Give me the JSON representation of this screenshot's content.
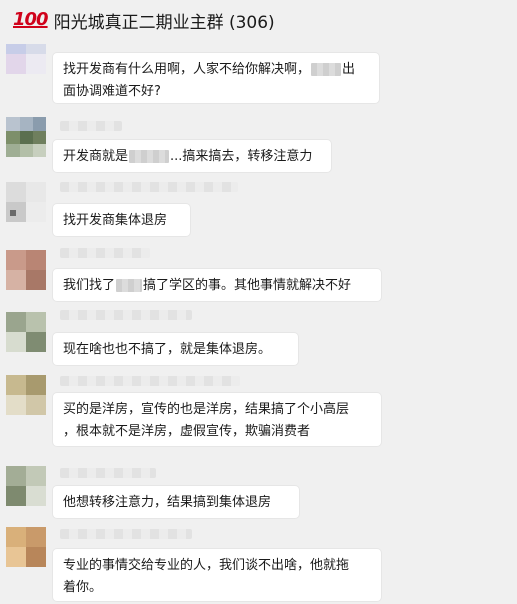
{
  "header": {
    "emoji": "100",
    "title": "阳光城真正二期业主群 (306)"
  },
  "messages": [
    {
      "line1_a": "找开发商有什么用啊，人家不给你解决啊，",
      "line1_b": "出",
      "line2": "面协调难道不好?"
    },
    {
      "text_a": "开发商就是",
      "text_b": "...搞来搞去，转移注意力"
    },
    {
      "text": "找开发商集体退房"
    },
    {
      "text_a": "我们找了",
      "text_b": "搞了学区的事。其他事情就解决不好"
    },
    {
      "text": "现在啥也也不搞了，就是集体退房。"
    },
    {
      "line1": "买的是洋房，宣传的也是洋房，结果搞了个小高层",
      "line2": "，根本就不是洋房，虚假宣传，欺骗消费者"
    },
    {
      "text": "他想转移注意力，结果搞到集体退房"
    },
    {
      "line1": "专业的事情交给专业的人，我们谈不出啥，他就拖",
      "line2": "着你。"
    }
  ]
}
